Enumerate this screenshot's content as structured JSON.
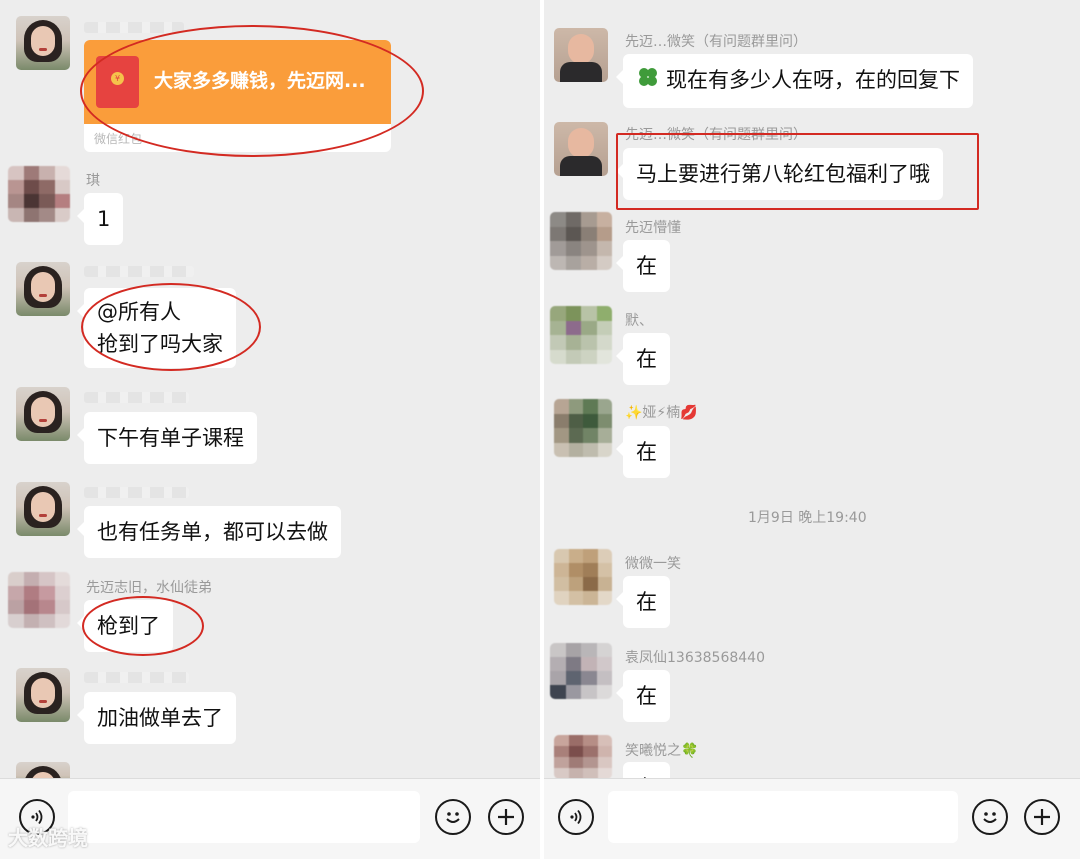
{
  "left": {
    "red_packet": {
      "title": "大家多多赚钱，先迈网...",
      "label": "微信红包"
    },
    "messages": [
      {
        "nick": "琪",
        "text": "1"
      },
      {
        "nick": "",
        "text": "@所有人"
      },
      {
        "nick": "",
        "text": "抢到了吗大家"
      },
      {
        "nick": "",
        "text": "下午有单子课程"
      },
      {
        "nick": "",
        "text": "也有任务单，都可以去做"
      },
      {
        "nick": "先迈志旧，水仙徒弟",
        "text": "枪到了"
      },
      {
        "nick": "",
        "text": "加油做单去了"
      }
    ]
  },
  "right": {
    "messages": [
      {
        "nick": "先迈…微笑（有问题群里问）",
        "text": "现在有多少人在呀，在的回复下"
      },
      {
        "nick": "先迈…微笑（有问题群里问）",
        "text": "马上要进行第八轮红包福利了哦"
      },
      {
        "nick": "先迈懵懂",
        "text": "在"
      },
      {
        "nick": "默、",
        "text": "在"
      },
      {
        "nick": "✨娅⚡楠💋",
        "text": "在"
      },
      {
        "nick": "微微一笑",
        "text": "在"
      },
      {
        "nick": "袁凤仙13638568440",
        "text": "在"
      },
      {
        "nick": "笑曦悦之🍀",
        "text": "在"
      }
    ],
    "timestamp": "1月9日 晚上19:40"
  },
  "icons": {
    "voice": "voice-icon",
    "emoji": "emoji-icon",
    "plus": "plus-icon",
    "clover": "clover-icon",
    "red_packet": "red-packet-icon"
  },
  "colors": {
    "red_packet": "#fa9d3b",
    "annotation": "#d32a22",
    "chat_bg": "#ededed"
  },
  "watermark": "大数跨境"
}
